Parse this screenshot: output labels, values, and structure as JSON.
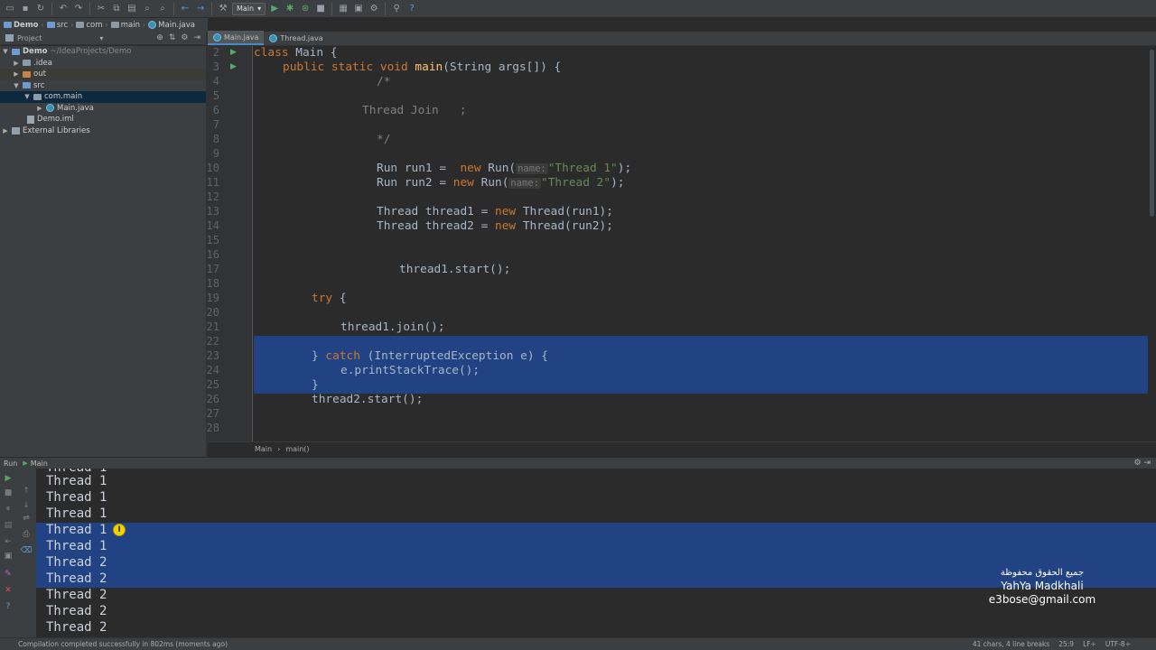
{
  "toolbar": {
    "run_config": "Main"
  },
  "navbar": {
    "crumbs": [
      "Demo",
      "src",
      "com",
      "main",
      "Main.java"
    ]
  },
  "project_panel": {
    "title": "Project",
    "items": [
      {
        "label": "Demo",
        "extra": "~/IdeaProjects/Demo"
      },
      {
        "label": ".idea"
      },
      {
        "label": "out"
      },
      {
        "label": "src"
      },
      {
        "label": "com.main"
      },
      {
        "label": "Main.java"
      },
      {
        "label": "Demo.iml"
      },
      {
        "label": "External Libraries"
      }
    ]
  },
  "editor": {
    "tabs": [
      {
        "label": "Main.java"
      },
      {
        "label": "Thread.java"
      }
    ],
    "line_numbers": [
      "2",
      "3",
      "4",
      "5",
      "6",
      "7",
      "8",
      "9",
      "10",
      "11",
      "12",
      "13",
      "14",
      "15",
      "16",
      "17",
      "18",
      "19",
      "20",
      "21",
      "22",
      "23",
      "24",
      "25",
      "26",
      "27",
      "28"
    ],
    "code": {
      "l2_kw": "class",
      "l2_rest": " Main {",
      "l3_kw": "public static void",
      "l3_fn": "main",
      "l3_rest": "(String args[]) {",
      "l4": "/*",
      "l6": "Thread Join   ;",
      "l8": "*/",
      "l10_a": "Run run1 =  ",
      "l10_kw": "new",
      "l10_b": " Run(",
      "l10_hint": "name:",
      "l10_str": "\"Thread 1\"",
      "l10_c": ");",
      "l11_a": "Run run2 = ",
      "l11_kw": "new",
      "l11_b": " Run(",
      "l11_hint": "name:",
      "l11_str": "\"Thread 2\"",
      "l11_c": ");",
      "l13_a": "Thread thread1 = ",
      "l13_kw": "new",
      "l13_b": " Thread(run1);",
      "l14_a": "Thread thread2 = ",
      "l14_kw": "new",
      "l14_b": " Thread(run2);",
      "l17": "thread1.start();",
      "l19_kw": "try",
      "l19_rest": " {",
      "l21": "thread1.join();",
      "l23_a": "} ",
      "l23_kw": "catch",
      "l23_b": " (InterruptedException e) {",
      "l24": "e.printStackTrace();",
      "l25": "}",
      "l26": "thread2.start();"
    },
    "breadcrumb": [
      "Main",
      "main()"
    ]
  },
  "run_panel": {
    "label": "Run",
    "config": "Main",
    "output": [
      "Thread 1",
      "Thread 1",
      "Thread 1",
      "Thread 1",
      "Thread 1",
      "Thread 1",
      "Thread 2",
      "Thread 2",
      "Thread 2",
      "Thread 2",
      "Thread 2"
    ]
  },
  "watermark": {
    "line1": "جميع الحقوق محفوظة",
    "line2": "YahYa Madkhali",
    "line3": "e3bose@gmail.com"
  },
  "status_bar": {
    "message": "Compilation completed successfully in 802ms (moments ago)",
    "selection": "41 chars, 4 line breaks",
    "position": "25:9",
    "line_sep": "LF÷",
    "encoding": "UTF-8÷"
  }
}
